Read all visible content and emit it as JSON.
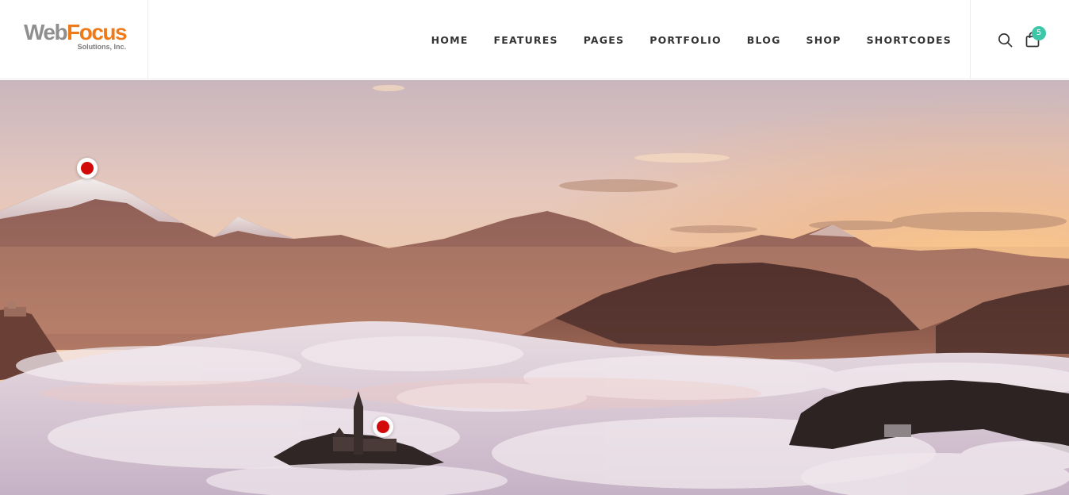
{
  "header": {
    "logo": {
      "part1": "Web",
      "part2": "Focus",
      "tagline": "Solutions, Inc."
    },
    "nav": [
      "HOME",
      "FEATURES",
      "PAGES",
      "PORTFOLIO",
      "BLOG",
      "SHOP",
      "SHORTCODES"
    ],
    "cart_count": "5"
  },
  "icons": {
    "search": "search-icon",
    "cart": "shopping-bag-icon"
  },
  "colors": {
    "accent": "#ef7a1a",
    "badge": "#3ec6a8",
    "hotspot": "#d20a0a"
  },
  "hero": {
    "hotspots": 2
  }
}
